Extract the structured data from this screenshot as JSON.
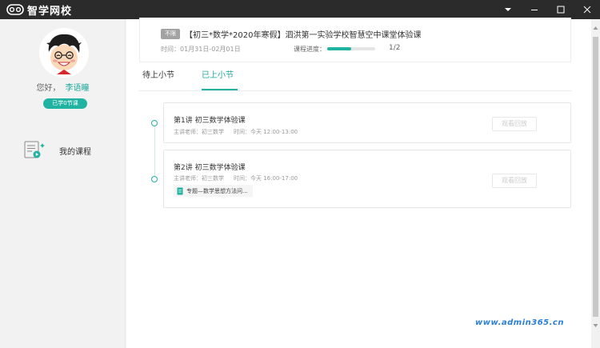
{
  "app": {
    "title": "智学网校"
  },
  "colors": {
    "accent": "#21b3a2",
    "titlebar": "#2b2b2b"
  },
  "user": {
    "greeting": "您好，",
    "name": "李语瞳",
    "badge": "已学0节课"
  },
  "nav": {
    "my_courses": "我的课程"
  },
  "course": {
    "tag": "不限",
    "title": "【初三*数学*2020年寒假】泗洪第一实验学校智慧空中课堂体验课",
    "time": "时间：01月31日-02月01日",
    "progress_label": "课程进度：",
    "progress_fraction": 0.5,
    "progress_count": "1/2"
  },
  "tabs": {
    "pending": "待上小节",
    "done": "已上小节"
  },
  "lessons": [
    {
      "title": "第1讲 初三数学体验课",
      "teacher": "主讲老师：初三数学",
      "time": "时间：今天 12:00-13:00",
      "replay": "观看回放"
    },
    {
      "title": "第2讲 初三数学体验课",
      "teacher": "主讲老师：初三数学",
      "time": "时间：今天 16:00-17:00",
      "replay": "观看回放",
      "material": "专题—数学思想方法问..."
    }
  ],
  "watermark": "www.admin365.cn"
}
